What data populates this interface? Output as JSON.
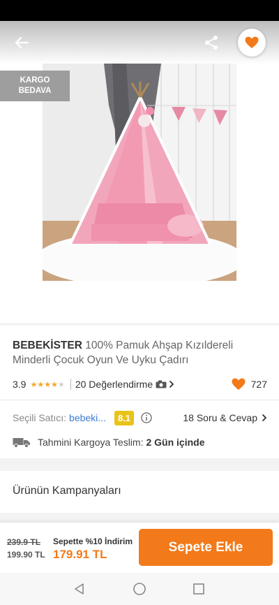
{
  "badge": {
    "line1": "KARGO",
    "line2": "BEDAVA"
  },
  "product": {
    "brand": "BEBEKİSTER",
    "name": "100% Pamuk Ahşap Kızıldereli Minderli Çocuk Oyun Ve Uyku Çadırı",
    "rating": "3.9",
    "rating_stars": 3.9,
    "reviews": "20 Değerlendirme",
    "likes": "727"
  },
  "seller": {
    "label": "Seçili Satıcı:",
    "name": "bebeki...",
    "score": "8.1",
    "qa": "18 Soru & Cevap"
  },
  "delivery": {
    "label": "Tahmini Kargoya Teslim:",
    "value": "2 Gün içinde"
  },
  "campaigns": {
    "title": "Ürünün Kampanyaları"
  },
  "buybar": {
    "old_price": "239.9 TL",
    "price": "199.90 TL",
    "discount_label": "Sepette %10 İndirim",
    "final_price": "179.91 TL",
    "add_button": "Sepete Ekle"
  },
  "colors": {
    "accent": "#f27a1a",
    "seller_link": "#3a7bd5",
    "score_badge": "#e8c31a",
    "star": "#f5a623"
  },
  "icons": [
    "back-arrow-icon",
    "share-icon",
    "heart-icon",
    "star-icon",
    "camera-icon",
    "chevron-right-icon",
    "info-icon",
    "truck-icon",
    "nav-back-icon",
    "nav-home-icon",
    "nav-recents-icon"
  ]
}
